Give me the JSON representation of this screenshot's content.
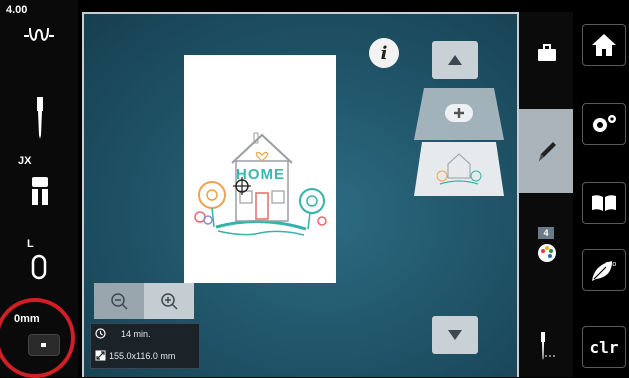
{
  "left_panel": {
    "tension_value": "4.00",
    "presser_foot_label": "JX",
    "hoop_label": "L",
    "stitch_length_label": "0mm"
  },
  "canvas": {
    "info_label": "i",
    "design_text": "HOME",
    "status": {
      "time": "14 min.",
      "size": "155.0x116.0 mm"
    }
  },
  "right_panel": {
    "color_count": "4"
  },
  "right_sidebar": {
    "clr_label": "clr"
  },
  "colors": {
    "canvas_bg": "#1f5266",
    "accent_highlight": "#d21f26",
    "button_gray": "#c9d0d6"
  }
}
